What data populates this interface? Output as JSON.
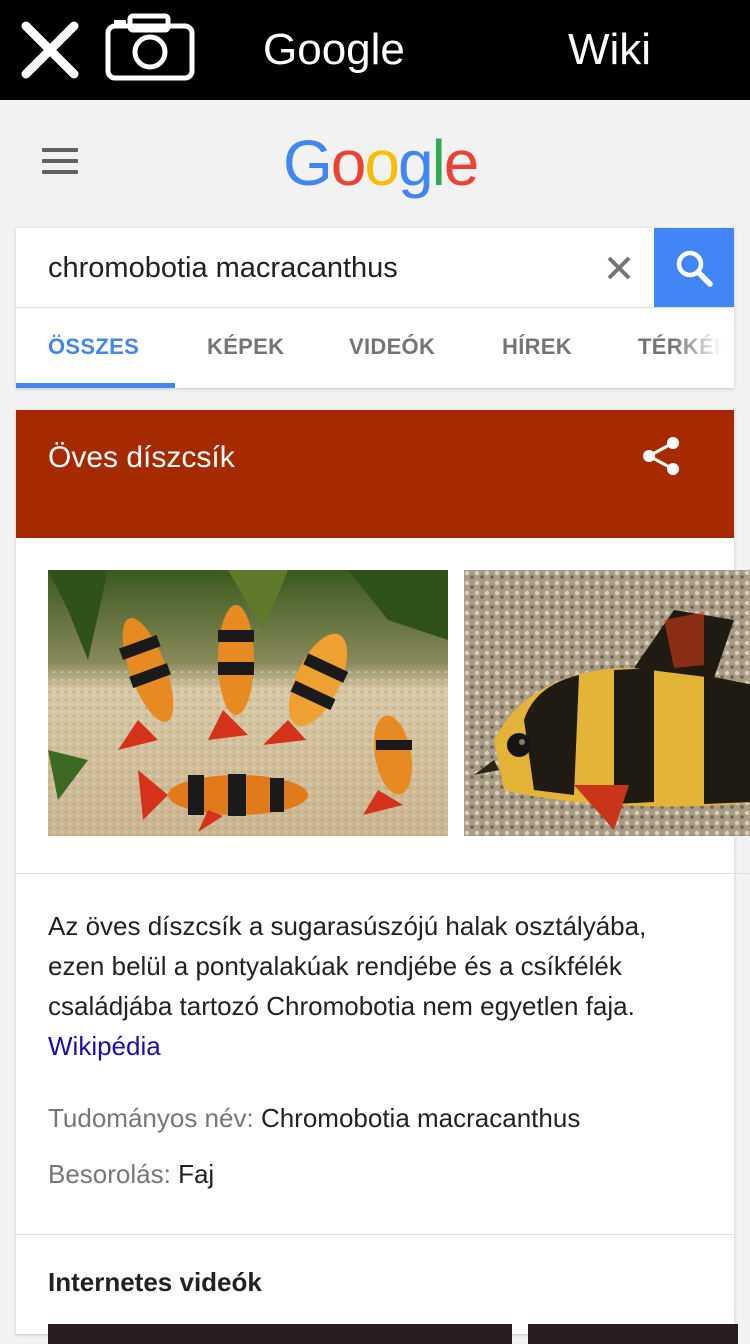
{
  "topbar": {
    "google_label": "Google",
    "wiki_label": "Wiki",
    "icons": [
      "close-icon",
      "camera-icon"
    ]
  },
  "header": {
    "logo": [
      "G",
      "o",
      "o",
      "g",
      "l",
      "e"
    ]
  },
  "search": {
    "query": "chromobotia macracanthus"
  },
  "tabs": [
    {
      "label": "ÖSSZES",
      "active": true
    },
    {
      "label": "KÉPEK",
      "active": false
    },
    {
      "label": "VIDEÓK",
      "active": false
    },
    {
      "label": "HÍREK",
      "active": false
    },
    {
      "label": "TÉRKÉP",
      "active": false
    }
  ],
  "knowledge_panel": {
    "title": "Öves díszcsík",
    "header_color": "#a52a00",
    "description": "Az öves díszcsík a sugarasúszójú halak osztályába, ezen belül a pontyalakúak rendjébe és a csíkfélék családjába tartozó Chromobotia nem egyetlen faja.",
    "source_link": "Wikipédia",
    "facts": [
      {
        "key": "Tudományos név:",
        "value": "Chromobotia macracanthus"
      },
      {
        "key": "Besorolás:",
        "value": "Faj"
      }
    ]
  },
  "videos": {
    "section_title": "Internetes videók"
  },
  "colors": {
    "accent": "#4285f4",
    "link": "#1a0dab"
  }
}
